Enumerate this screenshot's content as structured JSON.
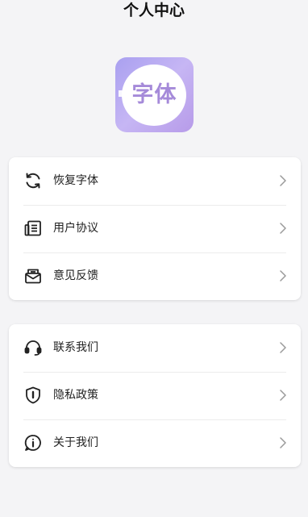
{
  "header": {
    "title": "个人中心"
  },
  "logo": {
    "text": "字体",
    "icon": "app-logo"
  },
  "groups": [
    {
      "items": [
        {
          "label": "恢复字体",
          "icon": "refresh-icon"
        },
        {
          "label": "用户协议",
          "icon": "document-icon"
        },
        {
          "label": "意见反馈",
          "icon": "feedback-mail-icon"
        }
      ]
    },
    {
      "items": [
        {
          "label": "联系我们",
          "icon": "headset-icon"
        },
        {
          "label": "隐私政策",
          "icon": "shield-icon"
        },
        {
          "label": "关于我们",
          "icon": "info-icon"
        }
      ]
    }
  ],
  "colors": {
    "background": "#f4f4f6",
    "card": "#ffffff",
    "logo_gradient_start": "#a9a0f0",
    "logo_gradient_end": "#b79be9",
    "logo_text": "#a58ad9",
    "chevron": "#9a9a9a"
  }
}
